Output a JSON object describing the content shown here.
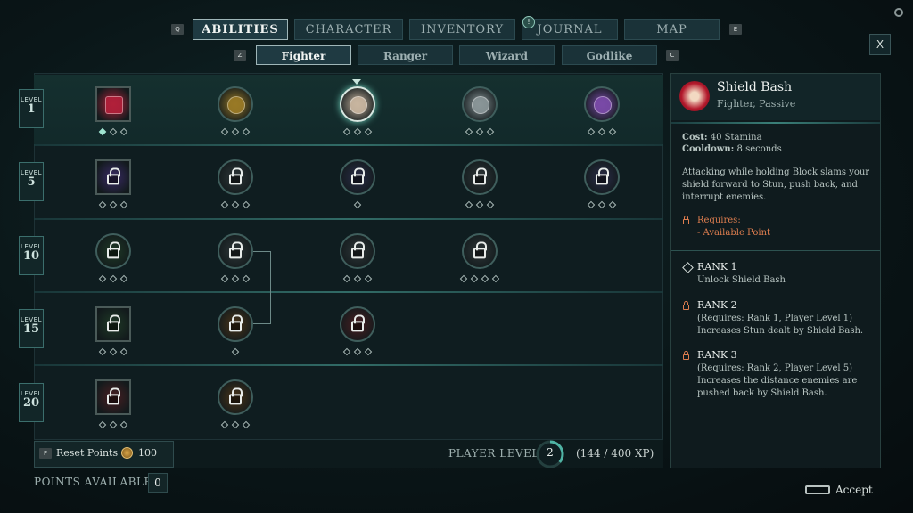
{
  "tabs": {
    "left_key": "Q",
    "right_key": "E",
    "items": [
      {
        "label": "ABILITIES",
        "active": true
      },
      {
        "label": "CHARACTER",
        "active": false
      },
      {
        "label": "INVENTORY",
        "active": false
      },
      {
        "label": "JOURNAL",
        "active": false,
        "badge": "!"
      },
      {
        "label": "MAP",
        "active": false
      }
    ]
  },
  "subtabs": {
    "left_key": "Z",
    "right_key": "C",
    "items": [
      {
        "label": "Fighter",
        "active": true
      },
      {
        "label": "Ranger",
        "active": false
      },
      {
        "label": "Wizard",
        "active": false
      },
      {
        "label": "Godlike",
        "active": false
      }
    ]
  },
  "close_label": "X",
  "levels": [
    {
      "label": "LEVEL",
      "value": "1"
    },
    {
      "label": "LEVEL",
      "value": "5"
    },
    {
      "label": "LEVEL",
      "value": "10"
    },
    {
      "label": "LEVEL",
      "value": "15"
    },
    {
      "label": "LEVEL",
      "value": "20"
    }
  ],
  "tree_nodes": [
    {
      "row": 0,
      "col": 0,
      "shape": "square",
      "locked": false,
      "icon": "demon-mask-icon",
      "ranks": 3,
      "filled": 1,
      "color": "#b2203a"
    },
    {
      "row": 0,
      "col": 1,
      "shape": "circle",
      "locked": false,
      "icon": "sun-shield-icon",
      "ranks": 3,
      "filled": 0,
      "color": "#9a7a26"
    },
    {
      "row": 0,
      "col": 2,
      "shape": "circle",
      "locked": false,
      "icon": "shield-bash-icon",
      "ranks": 3,
      "filled": 0,
      "color": "#c9b6a0",
      "selected": true
    },
    {
      "row": 0,
      "col": 3,
      "shape": "circle",
      "locked": false,
      "icon": "axe-icon",
      "ranks": 3,
      "filled": 0,
      "color": "#8a9698"
    },
    {
      "row": 0,
      "col": 4,
      "shape": "circle",
      "locked": false,
      "icon": "heart-shield-icon",
      "ranks": 3,
      "filled": 0,
      "color": "#7a4aa8"
    },
    {
      "row": 1,
      "col": 0,
      "shape": "square",
      "locked": true,
      "icon": "lock-icon",
      "ranks": 3,
      "filled": 0,
      "color": "#3a2a66"
    },
    {
      "row": 1,
      "col": 1,
      "shape": "circle",
      "locked": true,
      "icon": "lock-icon",
      "ranks": 3,
      "filled": 0,
      "color": "#2e3638"
    },
    {
      "row": 1,
      "col": 2,
      "shape": "circle",
      "locked": true,
      "icon": "lock-icon",
      "ranks": 1,
      "filled": 0,
      "color": "#2a2c48"
    },
    {
      "row": 1,
      "col": 3,
      "shape": "circle",
      "locked": true,
      "icon": "lock-icon",
      "ranks": 3,
      "filled": 0,
      "color": "#2e3638"
    },
    {
      "row": 1,
      "col": 4,
      "shape": "circle",
      "locked": true,
      "icon": "lock-icon",
      "ranks": 3,
      "filled": 0,
      "color": "#2a2c48"
    },
    {
      "row": 2,
      "col": 0,
      "shape": "circle",
      "locked": true,
      "icon": "lock-icon",
      "ranks": 3,
      "filled": 0,
      "color": "#1f3a26"
    },
    {
      "row": 2,
      "col": 1,
      "shape": "circle",
      "locked": true,
      "icon": "lock-icon",
      "ranks": 3,
      "filled": 0,
      "color": "#2e3638"
    },
    {
      "row": 2,
      "col": 2,
      "shape": "circle",
      "locked": true,
      "icon": "lock-icon",
      "ranks": 3,
      "filled": 0,
      "color": "#2e3638"
    },
    {
      "row": 2,
      "col": 3,
      "shape": "circle",
      "locked": true,
      "icon": "lock-icon",
      "ranks": 4,
      "filled": 0,
      "color": "#2e3638"
    },
    {
      "row": 3,
      "col": 0,
      "shape": "square",
      "locked": true,
      "icon": "lock-icon",
      "ranks": 3,
      "filled": 0,
      "color": "#1f3a26"
    },
    {
      "row": 3,
      "col": 1,
      "shape": "circle",
      "locked": true,
      "icon": "lock-icon",
      "ranks": 1,
      "filled": 0,
      "color": "#4a3418"
    },
    {
      "row": 3,
      "col": 2,
      "shape": "circle",
      "locked": true,
      "icon": "lock-icon",
      "ranks": 3,
      "filled": 0,
      "color": "#4a1e22"
    },
    {
      "row": 4,
      "col": 0,
      "shape": "square",
      "locked": true,
      "icon": "lock-icon",
      "ranks": 3,
      "filled": 0,
      "color": "#4a1e22"
    },
    {
      "row": 4,
      "col": 1,
      "shape": "circle",
      "locked": true,
      "icon": "lock-icon",
      "ranks": 3,
      "filled": 0,
      "color": "#4a3418"
    }
  ],
  "detail": {
    "title": "Shield Bash",
    "subtitle": "Fighter, Passive",
    "cost_label": "Cost:",
    "cost_value": "40 Stamina",
    "cooldown_label": "Cooldown:",
    "cooldown_value": "8 seconds",
    "description": [
      "Attacking while holding Block slams your",
      "shield forward to Stun, push back, and",
      "interrupt enemies."
    ],
    "requires_label": "Requires:",
    "requires_item": "- Available Point",
    "ranks": [
      {
        "title": "RANK 1",
        "req": "",
        "desc": [
          "Unlock Shield Bash"
        ]
      },
      {
        "title": "RANK 2",
        "req": "(Requires: Rank 1, Player Level 1)",
        "desc": [
          "Increases Stun dealt by Shield Bash."
        ]
      },
      {
        "title": "RANK 3",
        "req": "(Requires: Rank 2, Player Level 5)",
        "desc": [
          "Increases the distance enemies are",
          "pushed back by Shield Bash."
        ]
      }
    ]
  },
  "bottom": {
    "reset_key": "F",
    "reset_label": "Reset Points",
    "reset_cost": "100",
    "player_level_label": "PLAYER LEVEL",
    "player_level": "2",
    "xp": "(144 / 400 XP)",
    "xp_fraction": 0.36,
    "points_label": "POINTS AVAILABLE",
    "points_value": "0",
    "accept_label": "Accept"
  },
  "colors": {
    "accent": "#4fb3a4",
    "warning": "#df7e4f"
  }
}
